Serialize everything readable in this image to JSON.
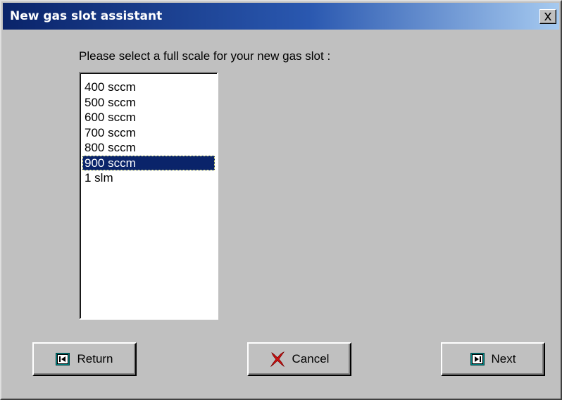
{
  "window": {
    "title": "New gas slot assistant"
  },
  "prompt": "Please select a full scale for your new gas slot :",
  "list": {
    "items": [
      "400 sccm",
      "500 sccm",
      "600 sccm",
      "700 sccm",
      "800 sccm",
      "900 sccm",
      "1 slm"
    ],
    "selected": "900 sccm"
  },
  "buttons": {
    "return_label": "Return",
    "cancel_label": "Cancel",
    "next_label": "Next"
  },
  "icons": {
    "close": "close-icon",
    "return": "step-back-icon",
    "cancel": "red-x-icon",
    "next": "step-forward-icon"
  },
  "colors": {
    "title_bar_start": "#0a246a",
    "title_bar_end": "#a6caf0",
    "selection": "#0a246a",
    "dialog_face": "#c0c0c0",
    "cancel_x": "#d01010",
    "nav_icon_teal": "#008080"
  }
}
